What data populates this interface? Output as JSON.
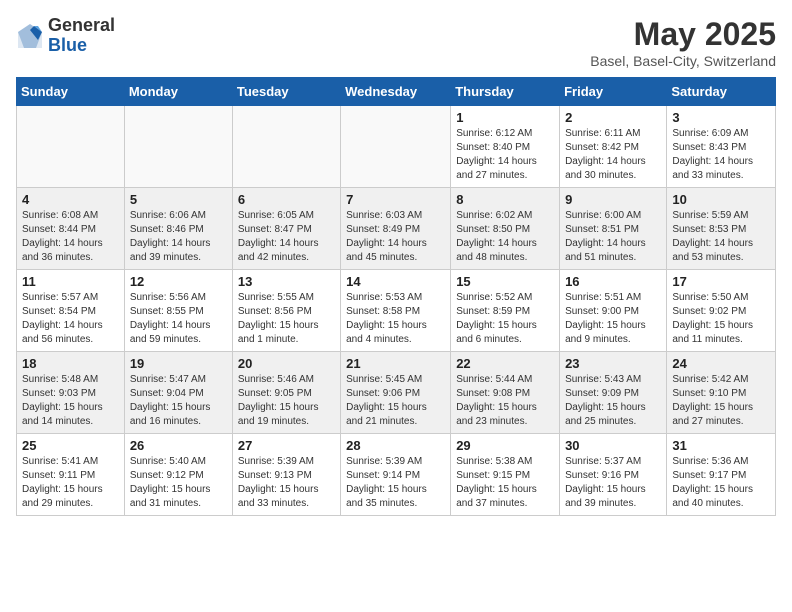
{
  "header": {
    "logo_general": "General",
    "logo_blue": "Blue",
    "title": "May 2025",
    "location": "Basel, Basel-City, Switzerland"
  },
  "weekdays": [
    "Sunday",
    "Monday",
    "Tuesday",
    "Wednesday",
    "Thursday",
    "Friday",
    "Saturday"
  ],
  "weeks": [
    [
      {
        "day": "",
        "info": ""
      },
      {
        "day": "",
        "info": ""
      },
      {
        "day": "",
        "info": ""
      },
      {
        "day": "",
        "info": ""
      },
      {
        "day": "1",
        "info": "Sunrise: 6:12 AM\nSunset: 8:40 PM\nDaylight: 14 hours\nand 27 minutes."
      },
      {
        "day": "2",
        "info": "Sunrise: 6:11 AM\nSunset: 8:42 PM\nDaylight: 14 hours\nand 30 minutes."
      },
      {
        "day": "3",
        "info": "Sunrise: 6:09 AM\nSunset: 8:43 PM\nDaylight: 14 hours\nand 33 minutes."
      }
    ],
    [
      {
        "day": "4",
        "info": "Sunrise: 6:08 AM\nSunset: 8:44 PM\nDaylight: 14 hours\nand 36 minutes."
      },
      {
        "day": "5",
        "info": "Sunrise: 6:06 AM\nSunset: 8:46 PM\nDaylight: 14 hours\nand 39 minutes."
      },
      {
        "day": "6",
        "info": "Sunrise: 6:05 AM\nSunset: 8:47 PM\nDaylight: 14 hours\nand 42 minutes."
      },
      {
        "day": "7",
        "info": "Sunrise: 6:03 AM\nSunset: 8:49 PM\nDaylight: 14 hours\nand 45 minutes."
      },
      {
        "day": "8",
        "info": "Sunrise: 6:02 AM\nSunset: 8:50 PM\nDaylight: 14 hours\nand 48 minutes."
      },
      {
        "day": "9",
        "info": "Sunrise: 6:00 AM\nSunset: 8:51 PM\nDaylight: 14 hours\nand 51 minutes."
      },
      {
        "day": "10",
        "info": "Sunrise: 5:59 AM\nSunset: 8:53 PM\nDaylight: 14 hours\nand 53 minutes."
      }
    ],
    [
      {
        "day": "11",
        "info": "Sunrise: 5:57 AM\nSunset: 8:54 PM\nDaylight: 14 hours\nand 56 minutes."
      },
      {
        "day": "12",
        "info": "Sunrise: 5:56 AM\nSunset: 8:55 PM\nDaylight: 14 hours\nand 59 minutes."
      },
      {
        "day": "13",
        "info": "Sunrise: 5:55 AM\nSunset: 8:56 PM\nDaylight: 15 hours\nand 1 minute."
      },
      {
        "day": "14",
        "info": "Sunrise: 5:53 AM\nSunset: 8:58 PM\nDaylight: 15 hours\nand 4 minutes."
      },
      {
        "day": "15",
        "info": "Sunrise: 5:52 AM\nSunset: 8:59 PM\nDaylight: 15 hours\nand 6 minutes."
      },
      {
        "day": "16",
        "info": "Sunrise: 5:51 AM\nSunset: 9:00 PM\nDaylight: 15 hours\nand 9 minutes."
      },
      {
        "day": "17",
        "info": "Sunrise: 5:50 AM\nSunset: 9:02 PM\nDaylight: 15 hours\nand 11 minutes."
      }
    ],
    [
      {
        "day": "18",
        "info": "Sunrise: 5:48 AM\nSunset: 9:03 PM\nDaylight: 15 hours\nand 14 minutes."
      },
      {
        "day": "19",
        "info": "Sunrise: 5:47 AM\nSunset: 9:04 PM\nDaylight: 15 hours\nand 16 minutes."
      },
      {
        "day": "20",
        "info": "Sunrise: 5:46 AM\nSunset: 9:05 PM\nDaylight: 15 hours\nand 19 minutes."
      },
      {
        "day": "21",
        "info": "Sunrise: 5:45 AM\nSunset: 9:06 PM\nDaylight: 15 hours\nand 21 minutes."
      },
      {
        "day": "22",
        "info": "Sunrise: 5:44 AM\nSunset: 9:08 PM\nDaylight: 15 hours\nand 23 minutes."
      },
      {
        "day": "23",
        "info": "Sunrise: 5:43 AM\nSunset: 9:09 PM\nDaylight: 15 hours\nand 25 minutes."
      },
      {
        "day": "24",
        "info": "Sunrise: 5:42 AM\nSunset: 9:10 PM\nDaylight: 15 hours\nand 27 minutes."
      }
    ],
    [
      {
        "day": "25",
        "info": "Sunrise: 5:41 AM\nSunset: 9:11 PM\nDaylight: 15 hours\nand 29 minutes."
      },
      {
        "day": "26",
        "info": "Sunrise: 5:40 AM\nSunset: 9:12 PM\nDaylight: 15 hours\nand 31 minutes."
      },
      {
        "day": "27",
        "info": "Sunrise: 5:39 AM\nSunset: 9:13 PM\nDaylight: 15 hours\nand 33 minutes."
      },
      {
        "day": "28",
        "info": "Sunrise: 5:39 AM\nSunset: 9:14 PM\nDaylight: 15 hours\nand 35 minutes."
      },
      {
        "day": "29",
        "info": "Sunrise: 5:38 AM\nSunset: 9:15 PM\nDaylight: 15 hours\nand 37 minutes."
      },
      {
        "day": "30",
        "info": "Sunrise: 5:37 AM\nSunset: 9:16 PM\nDaylight: 15 hours\nand 39 minutes."
      },
      {
        "day": "31",
        "info": "Sunrise: 5:36 AM\nSunset: 9:17 PM\nDaylight: 15 hours\nand 40 minutes."
      }
    ]
  ]
}
